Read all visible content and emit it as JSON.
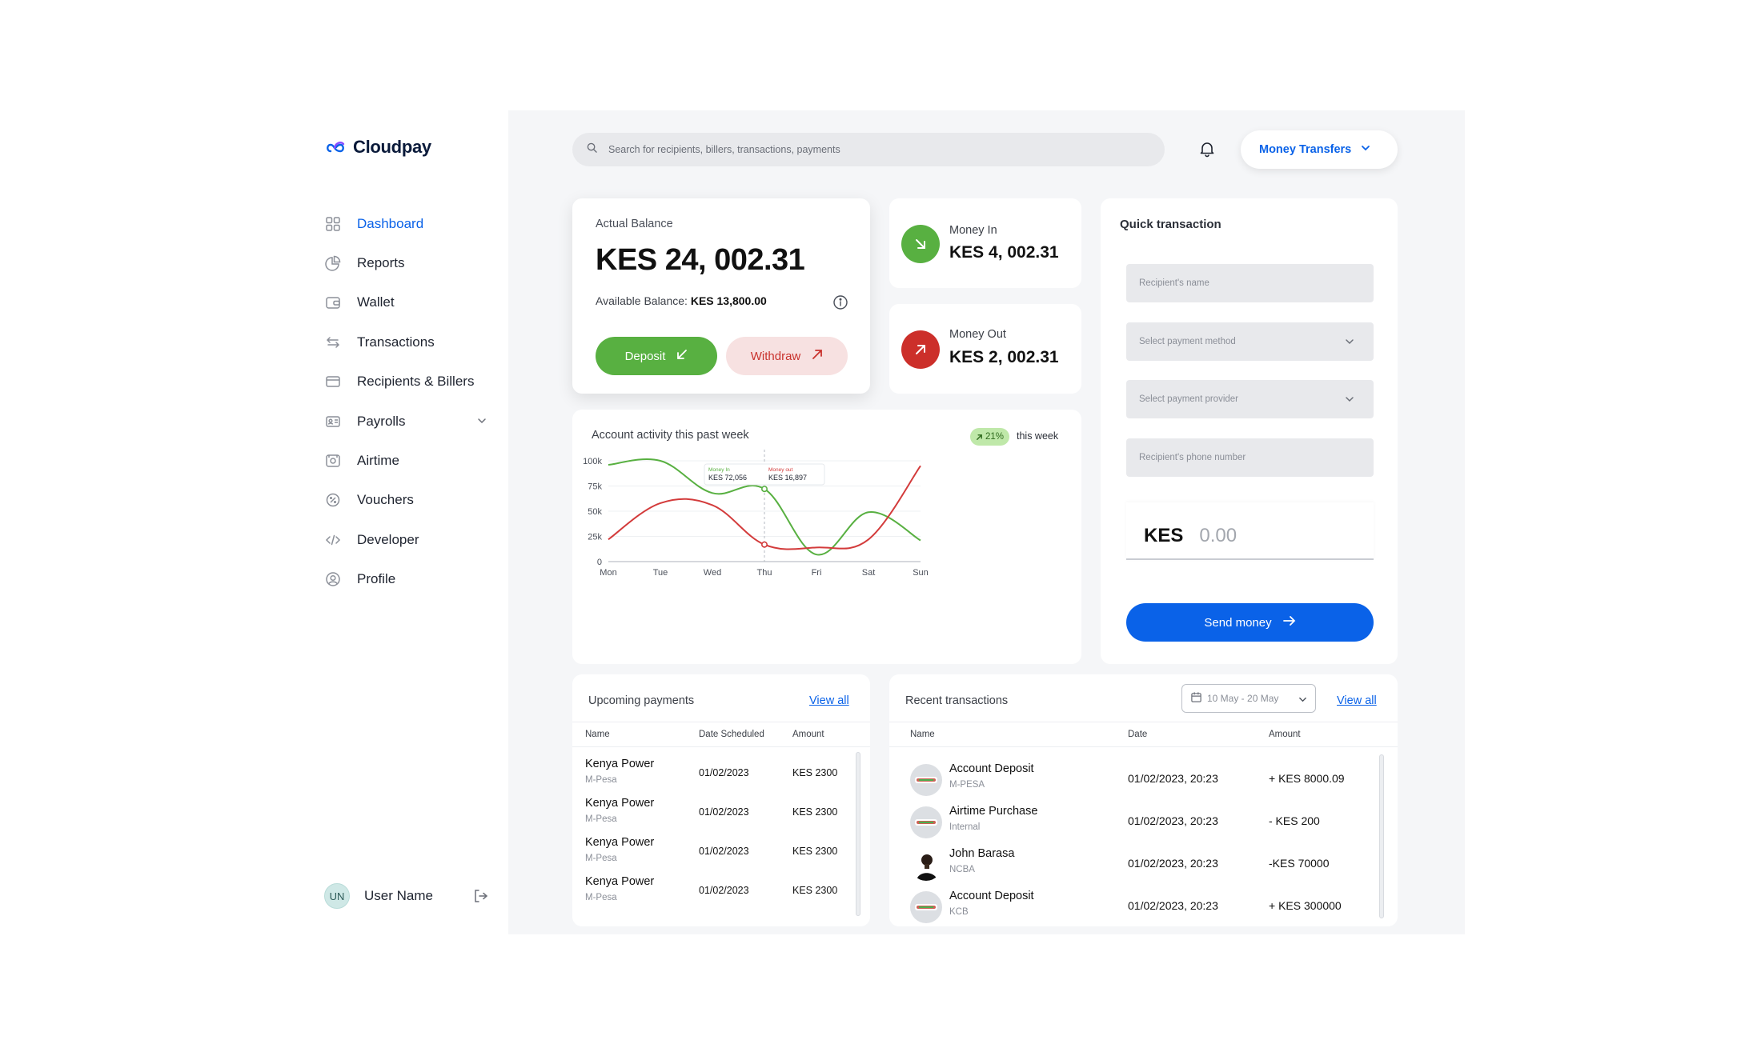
{
  "brand": {
    "name": "Cloudpay"
  },
  "sidebar": {
    "items": [
      {
        "label": "Dashboard",
        "icon": "grid-icon",
        "active": true
      },
      {
        "label": "Reports",
        "icon": "pie-chart-icon"
      },
      {
        "label": "Wallet",
        "icon": "wallet-icon"
      },
      {
        "label": "Transactions",
        "icon": "transfer-arrows-icon"
      },
      {
        "label": "Recipients & Billers",
        "icon": "card-icon"
      },
      {
        "label": "Payrolls",
        "icon": "id-card-icon",
        "has_submenu": true
      },
      {
        "label": "Airtime",
        "icon": "airtime-icon"
      },
      {
        "label": "Vouchers",
        "icon": "voucher-icon"
      },
      {
        "label": "Developer",
        "icon": "code-icon"
      },
      {
        "label": "Profile",
        "icon": "user-circle-icon"
      }
    ],
    "user": {
      "initials": "UN",
      "name": "User Name"
    }
  },
  "header": {
    "search_placeholder": "Search for recipients,  billers, transactions, payments",
    "mode_button": "Money Transfers"
  },
  "balance": {
    "label": "Actual Balance",
    "amount": "KES 24, 002.31",
    "available_label": "Available Balance:",
    "available_value": "KES 13,800.00",
    "deposit_label": "Deposit",
    "withdraw_label": "Withdraw"
  },
  "money_in": {
    "label": "Money In",
    "value": "KES 4, 002.31"
  },
  "money_out": {
    "label": "Money Out",
    "value": "KES 2, 002.31"
  },
  "chart": {
    "title": "Account activity this past week",
    "badge": "21%",
    "badge_label": "this week",
    "tooltip_in_label": "Money In",
    "tooltip_in_value": "KES 72,056",
    "tooltip_out_label": "Money out",
    "tooltip_out_value": "KES 16,897"
  },
  "chart_data": {
    "type": "line",
    "categories": [
      "Mon",
      "Tue",
      "Wed",
      "Thu",
      "Fri",
      "Sat",
      "Sun"
    ],
    "yticks": [
      "0",
      "25k",
      "50k",
      "75k",
      "100k"
    ],
    "ylim": [
      0,
      100000
    ],
    "series": [
      {
        "name": "Money In",
        "color": "#58b041",
        "values": [
          96000,
          100000,
          68000,
          72056,
          7000,
          49000,
          21000
        ]
      },
      {
        "name": "Money out",
        "color": "#d33b3b",
        "values": [
          22000,
          58000,
          56000,
          16897,
          14000,
          22000,
          95000
        ]
      }
    ],
    "highlight_category": "Thu",
    "grid": true
  },
  "quick": {
    "title": "Quick transaction",
    "recipient_name_placeholder": "Recipient's name",
    "payment_method_placeholder": "Select payment method",
    "payment_provider_placeholder": "Select payment provider",
    "phone_placeholder": "Recipient's phone number",
    "currency": "KES",
    "amount_placeholder": "0.00",
    "send_label": "Send money"
  },
  "upcoming": {
    "title": "Upcoming payments",
    "view_all": "View all",
    "columns": [
      "Name",
      "Date Scheduled",
      "Amount"
    ],
    "rows": [
      {
        "name": "Kenya Power",
        "sub": "M-Pesa",
        "date": "01/02/2023",
        "amount": "KES 2300"
      },
      {
        "name": "Kenya Power",
        "sub": "M-Pesa",
        "date": "01/02/2023",
        "amount": "KES 2300"
      },
      {
        "name": "Kenya Power",
        "sub": "M-Pesa",
        "date": "01/02/2023",
        "amount": "KES 2300"
      },
      {
        "name": "Kenya Power",
        "sub": "M-Pesa",
        "date": "01/02/2023",
        "amount": "KES 2300"
      }
    ]
  },
  "recent": {
    "title": "Recent transactions",
    "date_range": "10 May - 20 May",
    "view_all": "View all",
    "columns": [
      "Name",
      "Date",
      "Amount"
    ],
    "rows": [
      {
        "name": "Account Deposit",
        "sub": "M-PESA",
        "date": "01/02/2023, 20:23",
        "amount": "+ KES 8000.09",
        "avatar": "bank-logo"
      },
      {
        "name": "Airtime Purchase",
        "sub": "Internal",
        "date": "01/02/2023, 20:23",
        "amount": "- KES 200",
        "avatar": "bank-logo"
      },
      {
        "name": "John Barasa",
        "sub": "NCBA",
        "date": "01/02/2023, 20:23",
        "amount": "-KES 70000",
        "avatar": "person-photo"
      },
      {
        "name": "Account Deposit",
        "sub": "KCB",
        "date": "01/02/2023, 20:23",
        "amount": "+ KES 300000",
        "avatar": "bank-logo"
      }
    ]
  }
}
